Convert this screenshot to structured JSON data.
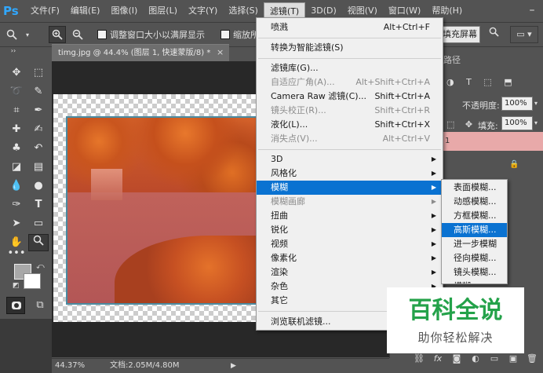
{
  "app": {
    "logo": "Ps"
  },
  "menubar": {
    "items": [
      "文件(F)",
      "编辑(E)",
      "图像(I)",
      "图层(L)",
      "文字(Y)",
      "选择(S)",
      "滤镜(T)",
      "3D(D)",
      "视图(V)",
      "窗口(W)",
      "帮助(H)"
    ],
    "active": "滤镜(T)"
  },
  "options": {
    "resize_windows_label": "调整窗口大小以满屏显示",
    "zoom_all_label": "缩放所有",
    "fill_screen_label": "填充屏幕"
  },
  "document": {
    "tab_title": "timg.jpg @ 44.4% (图层 1, 快速蒙版/8) *",
    "close": "×"
  },
  "filter_menu": {
    "items": [
      {
        "label": "喷溅",
        "shortcut": "Alt+Ctrl+F",
        "enabled": true
      },
      {
        "label": "转换为智能滤镜(S)",
        "enabled": true
      },
      {
        "label": "滤镜库(G)...",
        "enabled": true
      },
      {
        "label": "自适应广角(A)...",
        "shortcut": "Alt+Shift+Ctrl+A",
        "enabled": false
      },
      {
        "label": "Camera Raw 滤镜(C)...",
        "shortcut": "Shift+Ctrl+A",
        "enabled": true
      },
      {
        "label": "镜头校正(R)...",
        "shortcut": "Shift+Ctrl+R",
        "enabled": false
      },
      {
        "label": "液化(L)...",
        "shortcut": "Shift+Ctrl+X",
        "enabled": true
      },
      {
        "label": "消失点(V)...",
        "shortcut": "Alt+Ctrl+V",
        "enabled": false
      },
      {
        "label": "3D",
        "submenu": true,
        "enabled": true
      },
      {
        "label": "风格化",
        "submenu": true,
        "enabled": true
      },
      {
        "label": "模糊",
        "submenu": true,
        "enabled": true,
        "highlighted": true
      },
      {
        "label": "模糊画廊",
        "submenu": true,
        "enabled": false
      },
      {
        "label": "扭曲",
        "submenu": true,
        "enabled": true
      },
      {
        "label": "锐化",
        "submenu": true,
        "enabled": true
      },
      {
        "label": "视频",
        "submenu": true,
        "enabled": true
      },
      {
        "label": "像素化",
        "submenu": true,
        "enabled": true
      },
      {
        "label": "渲染",
        "submenu": true,
        "enabled": true
      },
      {
        "label": "杂色",
        "submenu": true,
        "enabled": true
      },
      {
        "label": "其它",
        "submenu": true,
        "enabled": true
      },
      {
        "label": "浏览联机滤镜...",
        "enabled": true
      }
    ]
  },
  "blur_submenu": {
    "items": [
      "表面模糊...",
      "动感模糊...",
      "方框模糊...",
      "高斯模糊...",
      "进一步模糊",
      "径向模糊...",
      "镜头模糊...",
      "模糊"
    ],
    "highlighted": "高斯模糊..."
  },
  "layers_panel": {
    "tab_label": "路径",
    "opacity_label": "不透明度:",
    "opacity_value": "100%",
    "fill_label": "填充:",
    "fill_value": "100%",
    "layer_number": "1"
  },
  "status": {
    "zoom": "44.37%",
    "doc_size": "文档:2.05M/4.80M",
    "arrow": "▶"
  },
  "watermark": {
    "title": "百科全说",
    "subtitle": "助你轻松解决"
  },
  "icons": {
    "zoom_tool": "zoom-icon",
    "zoom_in": "zoom-in-icon",
    "zoom_out": "zoom-out-icon",
    "search": "search-icon",
    "lock": "lock-icon"
  },
  "colors": {
    "accent": "#0a72d1",
    "mask_overlay": "#b24a3a",
    "watermark_green": "#24a24a"
  }
}
